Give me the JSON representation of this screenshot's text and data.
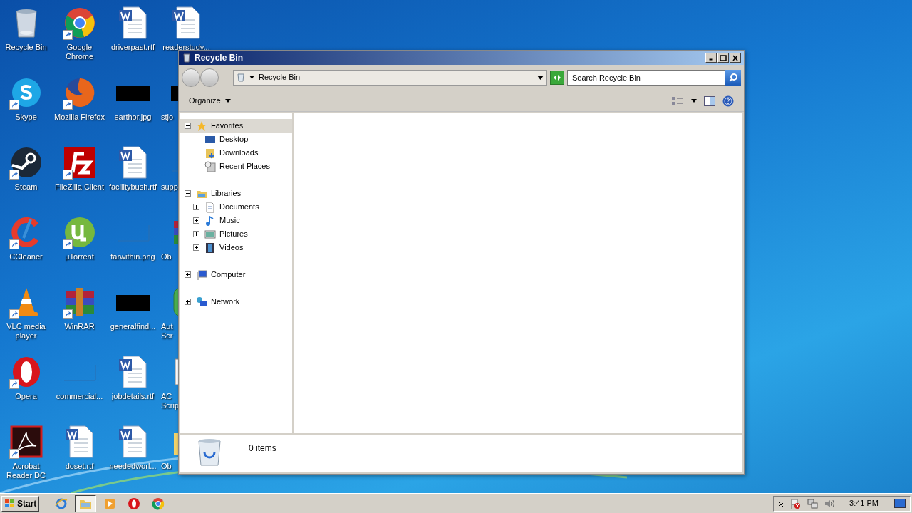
{
  "desktop_icons": [
    {
      "label": "Recycle Bin",
      "kind": "recycle",
      "shortcut": false
    },
    {
      "label": "Skype",
      "kind": "skype",
      "shortcut": true
    },
    {
      "label": "Steam",
      "kind": "steam",
      "shortcut": true
    },
    {
      "label": "CCleaner",
      "kind": "ccleaner",
      "shortcut": true
    },
    {
      "label": "VLC media player",
      "kind": "vlc",
      "shortcut": true
    },
    {
      "label": "Opera",
      "kind": "opera",
      "shortcut": true
    },
    {
      "label": "Acrobat Reader DC",
      "kind": "acrobat",
      "shortcut": true
    },
    {
      "label": "Google Chrome",
      "kind": "chrome",
      "shortcut": true
    },
    {
      "label": "Mozilla Firefox",
      "kind": "firefox",
      "shortcut": true
    },
    {
      "label": "FileZilla Client",
      "kind": "filezilla",
      "shortcut": true
    },
    {
      "label": "µTorrent",
      "kind": "utorrent",
      "shortcut": true
    },
    {
      "label": "WinRAR",
      "kind": "winrar",
      "shortcut": true
    },
    {
      "label": "commercial...",
      "kind": "blank-image",
      "shortcut": false
    },
    {
      "label": "doset.rtf",
      "kind": "word",
      "shortcut": false
    },
    {
      "label": "driverpast.rtf",
      "kind": "word",
      "shortcut": false
    },
    {
      "label": "earthor.jpg",
      "kind": "black-image",
      "shortcut": false
    },
    {
      "label": "facilitybush.rtf",
      "kind": "word",
      "shortcut": false
    },
    {
      "label": "farwithin.png",
      "kind": "blank-image",
      "shortcut": false
    },
    {
      "label": "generalfind...",
      "kind": "black-image",
      "shortcut": false
    },
    {
      "label": "jobdetails.rtf",
      "kind": "word",
      "shortcut": false
    },
    {
      "label": "neededworl...",
      "kind": "word",
      "shortcut": false
    },
    {
      "label": "readerstudy...",
      "kind": "word",
      "shortcut": false
    },
    {
      "label": "stjo",
      "kind": "black-image",
      "shortcut": false
    },
    {
      "label": "supp",
      "kind": "blank-image",
      "shortcut": false
    },
    {
      "label": "Ob",
      "kind": "winrar",
      "shortcut": false
    },
    {
      "label": "Aut Scr",
      "kind": "green-app",
      "shortcut": false
    },
    {
      "label": "AC Scrip",
      "kind": "framed-image",
      "shortcut": false
    },
    {
      "label": "Ob",
      "kind": "folder",
      "shortcut": false
    }
  ],
  "window": {
    "title": "Recycle Bin",
    "address": "Recycle Bin",
    "search": {
      "placeholder": "Search Recycle Bin"
    },
    "toolbar": {
      "organize": "Organize"
    },
    "nav_tree": [
      {
        "label": "Favorites",
        "kind": "star",
        "expanded": true,
        "selected": true,
        "children": [
          {
            "label": "Desktop",
            "kind": "desktop",
            "selected": false
          },
          {
            "label": "Downloads",
            "kind": "downloads",
            "selected": false
          },
          {
            "label": "Recent Places",
            "kind": "recent",
            "selected": false
          }
        ]
      },
      {
        "label": "Libraries",
        "kind": "libraries",
        "expanded": true,
        "selected": false,
        "children": [
          {
            "label": "Documents",
            "kind": "documents",
            "expanded": false,
            "selected": false
          },
          {
            "label": "Music",
            "kind": "music",
            "expanded": false,
            "selected": false
          },
          {
            "label": "Pictures",
            "kind": "pictures",
            "expanded": false,
            "selected": false
          },
          {
            "label": "Videos",
            "kind": "videos",
            "expanded": false,
            "selected": false
          }
        ]
      },
      {
        "label": "Computer",
        "kind": "computer",
        "expanded": false,
        "selected": false
      },
      {
        "label": "Network",
        "kind": "network",
        "expanded": false,
        "selected": false
      }
    ],
    "status": "0 items"
  },
  "taskbar": {
    "start": "Start",
    "apps": [
      {
        "kind": "ie",
        "selected": false
      },
      {
        "kind": "explorer",
        "selected": true
      },
      {
        "kind": "media",
        "selected": false
      },
      {
        "kind": "opera",
        "selected": false
      },
      {
        "kind": "chrome",
        "selected": false
      }
    ],
    "clock": "3:41 PM"
  }
}
